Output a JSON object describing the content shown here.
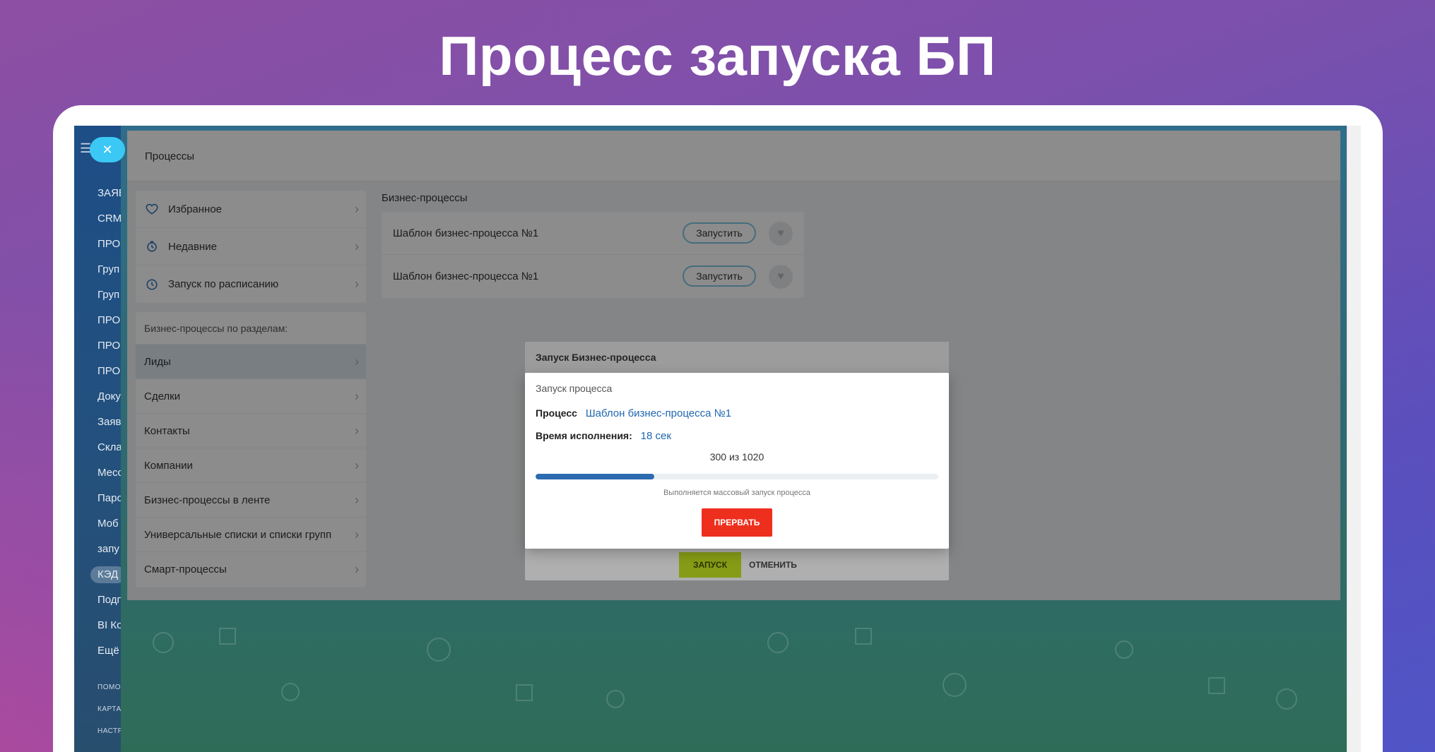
{
  "page_title": "Процесс запуска БП",
  "left_nav": {
    "items": [
      "ЗАЯВ",
      "CRM",
      "ПРО",
      "Груп",
      "Груп",
      "ПРО",
      "ПРО",
      "ПРО",
      "Доку",
      "Заяв",
      "Скла",
      "Месс",
      "Паро",
      "Моб",
      "запу",
      "КЭД",
      "Подп",
      "BI Ко",
      "Ещё"
    ],
    "active_item": "КЭД",
    "footer": [
      "ПОМО",
      "КАРТА",
      "НАСТР"
    ]
  },
  "panel": {
    "title": "Процессы",
    "favorites": [
      {
        "label": "Избранное",
        "icon": "heart-icon"
      },
      {
        "label": "Недавние",
        "icon": "recent-icon"
      },
      {
        "label": "Запуск по расписанию",
        "icon": "clock-icon"
      }
    ],
    "sections_heading": "Бизнес-процессы по разделам:",
    "sections": [
      "Лиды",
      "Сделки",
      "Контакты",
      "Компании",
      "Бизнес-процессы в ленте",
      "Универсальные списки и списки групп",
      "Смарт-процессы"
    ],
    "active_section": "Лиды",
    "bp_heading": "Бизнес-процессы",
    "bp_list": [
      {
        "name": "Шаблон бизнес-процесса №1",
        "run_label": "Запустить"
      },
      {
        "name": "Шаблон бизнес-процесса №1",
        "run_label": "Запустить"
      }
    ]
  },
  "launch_dialog": {
    "title": "Запуск Бизнес-процесса",
    "start_label": "ЗАПУСК",
    "cancel_label": "ОТМЕНИТЬ"
  },
  "progress_dialog": {
    "subtitle": "Запуск процесса",
    "process_label": "Процесс",
    "process_value": "Шаблон бизнес-процесса №1",
    "time_label": "Время исполнения:",
    "time_value": "18 сек",
    "count_text": "300 из 1020",
    "done": 300,
    "total": 1020,
    "note": "Выполняется массовый запуск процесса",
    "stop_label": "ПРЕРВАТЬ"
  },
  "colors": {
    "accent_blue": "#2d6bb0",
    "stop_red": "#ee2f1e",
    "start_green": "#bcd81f",
    "close_cyan": "#3bc8f5"
  }
}
